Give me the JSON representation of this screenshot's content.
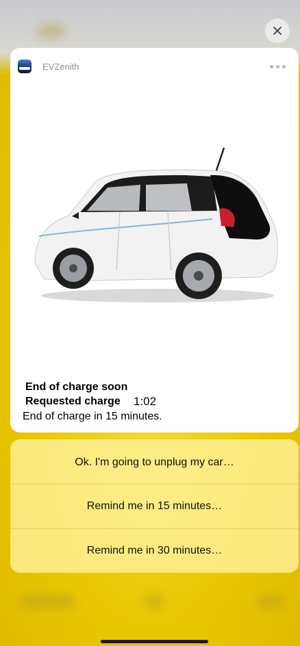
{
  "notification": {
    "app_name": "EVZenith",
    "title": "End of charge soon",
    "requested_label": "Requested charge",
    "requested_value": "1:02",
    "body": "End of charge in 15 minutes."
  },
  "actions": [
    {
      "label": "Ok. I'm going to unplug my car…"
    },
    {
      "label": "Remind me in 15 minutes…"
    },
    {
      "label": "Remind me in 30 minutes…"
    }
  ],
  "icons": {
    "close": "close-icon",
    "more": "more-icon",
    "app": "app-icon"
  },
  "colors": {
    "background": "#e4c400",
    "card": "#ffffff",
    "actions_bg": "#fff3a0",
    "car_body": "#f2f2f2",
    "car_roof": "#111111",
    "tail_light": "#c8202a"
  }
}
